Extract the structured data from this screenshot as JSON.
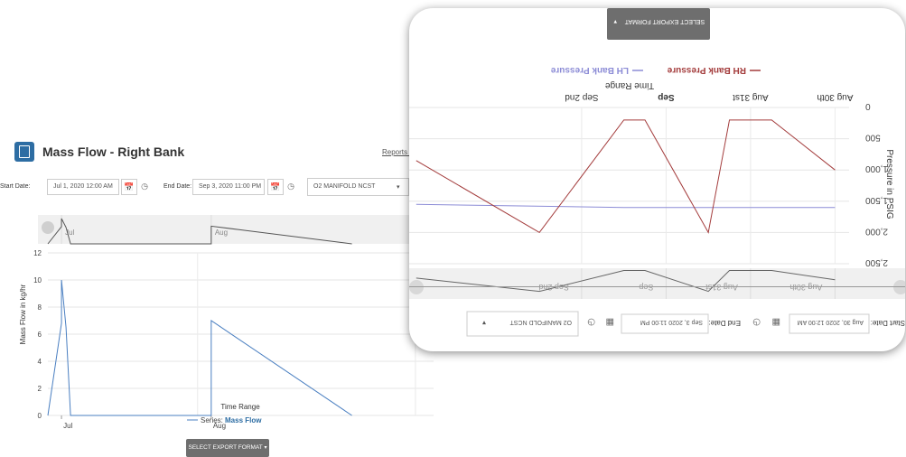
{
  "page": {
    "title": "Mass Flow - Right Bank",
    "reports_link": "Reports M",
    "start_label": "Start Date:",
    "start_value": "Jul 1, 2020 12:00 AM",
    "end_label": "End Date:",
    "end_value": "Sep 3, 2020 11:00 PM",
    "select_value": "O2 MANIFOLD NCST",
    "export_label": "SELECT EXPORT FORMAT",
    "icons": [
      "report-icon",
      "calendar-icon",
      "clock-icon",
      "chevron-down-icon"
    ]
  },
  "panel": {
    "start_label": "Start Date:",
    "start_value": "Aug 30, 2020 12:00 AM",
    "end_label": "End Date:",
    "end_value": "Sep 3, 2020 11:00 PM",
    "select_value": "O2 MANIFOLD NCST",
    "export_label": "SELECT EXPORT FORMAT"
  },
  "chart_data": [
    {
      "type": "line",
      "xlabel": "Time Range",
      "ylabel": "Mass Flow in kg/hr",
      "ylim": [
        0,
        12
      ],
      "yticks": [
        0,
        2,
        4,
        6,
        8,
        10,
        12
      ],
      "xticks": [
        "Jul",
        "Aug"
      ],
      "navigator_labels": [
        "Jul",
        "Aug"
      ],
      "legend_prefix": "Series:",
      "grid": true,
      "series": [
        {
          "name": "Mass Flow",
          "color": "#4a7fc1",
          "x": [
            "2020-06-28",
            "2020-07-01",
            "2020-07-01",
            "2020-07-02",
            "2020-07-03",
            "2020-08-03",
            "2020-08-03",
            "2020-09-03"
          ],
          "y": [
            0,
            6.8,
            10,
            6.5,
            0,
            0,
            7,
            0
          ]
        }
      ]
    },
    {
      "type": "line",
      "xlabel": "Time Range",
      "ylabel": "Pressure in PSIG",
      "ylim": [
        0,
        2500
      ],
      "yticks": [
        0,
        500,
        1000,
        1500,
        2000,
        2500
      ],
      "xticks": [
        "Aug 30th",
        "Aug 31st",
        "Sep",
        "Sep 2nd"
      ],
      "navigator_labels": [
        "Aug 30th",
        "Aug 31st",
        "Sep",
        "Sep 2nd"
      ],
      "grid": true,
      "series": [
        {
          "name": "RH Bank Pressure",
          "color": "#a33b3b",
          "x": [
            "2020-08-30 00:00",
            "2020-08-30 18:00",
            "2020-08-31 06:00",
            "2020-08-31 12:00",
            "2020-09-01 06:00",
            "2020-09-01 12:00",
            "2020-09-02 12:00",
            "2020-09-03 23:00"
          ],
          "y": [
            1000,
            200,
            200,
            2000,
            200,
            200,
            2000,
            850
          ]
        },
        {
          "name": "LH Bank Pressure",
          "color": "#8c8cd6",
          "x": [
            "2020-08-30 00:00",
            "2020-08-31 12:00",
            "2020-09-01 12:00",
            "2020-09-03 23:00"
          ],
          "y": [
            1600,
            1600,
            1600,
            1550
          ]
        }
      ]
    }
  ]
}
